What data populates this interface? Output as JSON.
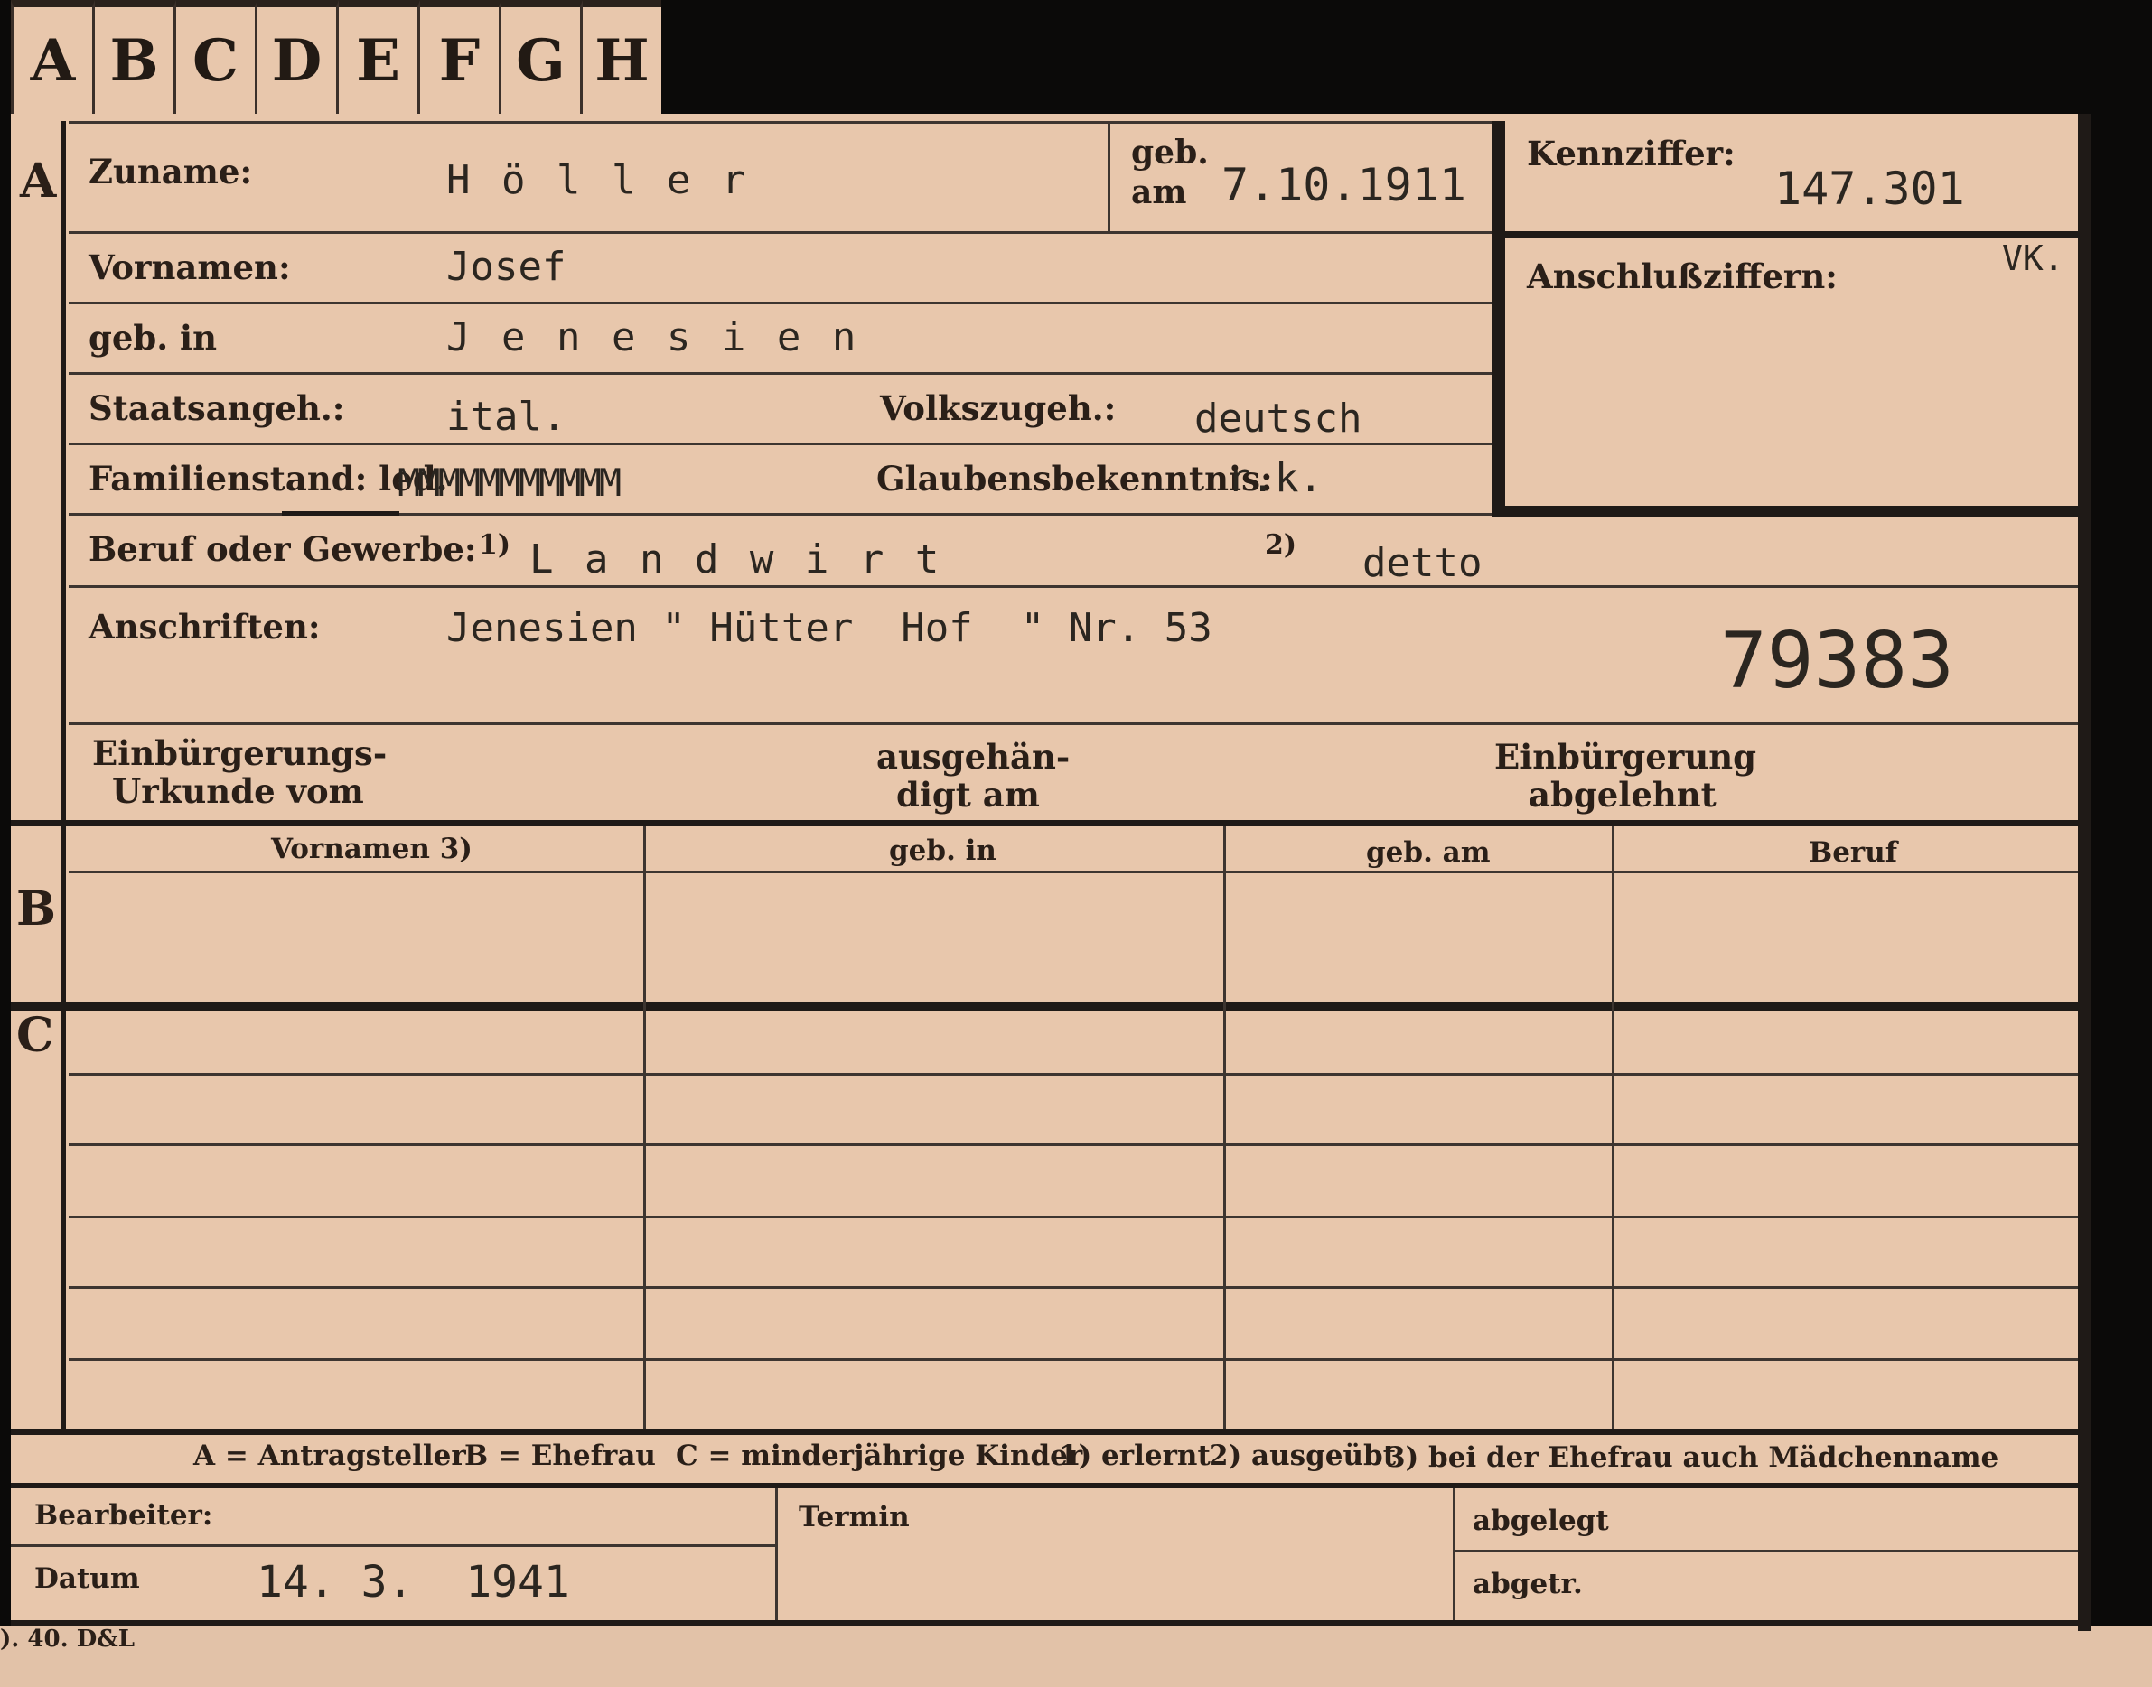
{
  "tabs": [
    "A",
    "B",
    "C",
    "D",
    "E",
    "F",
    "G",
    "H"
  ],
  "sections": {
    "a": "A",
    "b": "B",
    "c": "C"
  },
  "header": {
    "zuname_label": "Zuname:",
    "zuname_value": "H ö l l e r",
    "geb_label_top": "geb.",
    "geb_label_bottom": "am",
    "geb_am_value": "7.10.1911",
    "kennziffer_label": "Kennziffer:",
    "kennziffer_value": "147.301",
    "anschluss_label": "Anschlußziffern:",
    "anschluss_value": "VK.",
    "vornamen_label": "Vornamen:",
    "vornamen_value": "Josef",
    "gebin_label": "geb. in",
    "gebin_value": "J e n e s i e n",
    "staat_label": "Staatsangeh.:",
    "staat_value": "ital.",
    "volk_label": "Volkszugeh.:",
    "volk_value": "deutsch",
    "familien_label": "Familienstand: led.",
    "familien_struck": "MMMMMMMMMMM",
    "glauben_label": "Glaubensbekenntnis:",
    "glauben_value": "r.k.",
    "beruf_label": "Beruf oder Gewerbe:",
    "beruf_note1": "1)",
    "beruf_value1": "L a n d w i r t",
    "beruf_note2": "2)",
    "beruf_value2": "detto",
    "anschriften_label": "Anschriften:",
    "anschriften_value": "Jenesien \" Hütter  Hof  \" Nr. 53",
    "stamp_number": "79383",
    "einb_urkunde_line1": "Einbürgerungs-",
    "einb_urkunde_line2": "Urkunde vom",
    "ausgeh_line1": "ausgehän-",
    "ausgeh_line2": "digt am",
    "einb_abgelehnt_line1": "Einbürgerung",
    "einb_abgelehnt_line2": "abgelehnt"
  },
  "table": {
    "columns": [
      "Vornamen 3)",
      "geb. in",
      "geb. am",
      "Beruf"
    ]
  },
  "legend": {
    "a": "A = Antragsteller",
    "b": "B = Ehefrau",
    "c": "C = minderjährige Kinder",
    "n1": "1) erlernt",
    "n2": "2) ausgeübt",
    "n3": "3) bei der Ehefrau auch Mädchenname"
  },
  "footer": {
    "bearbeiter_label": "Bearbeiter:",
    "datum_label": "Datum",
    "datum_value": "14. 3.  1941",
    "termin_label": "Termin",
    "abgelegt_label": "abgelegt",
    "abgetr_label": "abgetr."
  },
  "print_code": "). 40. D&L"
}
